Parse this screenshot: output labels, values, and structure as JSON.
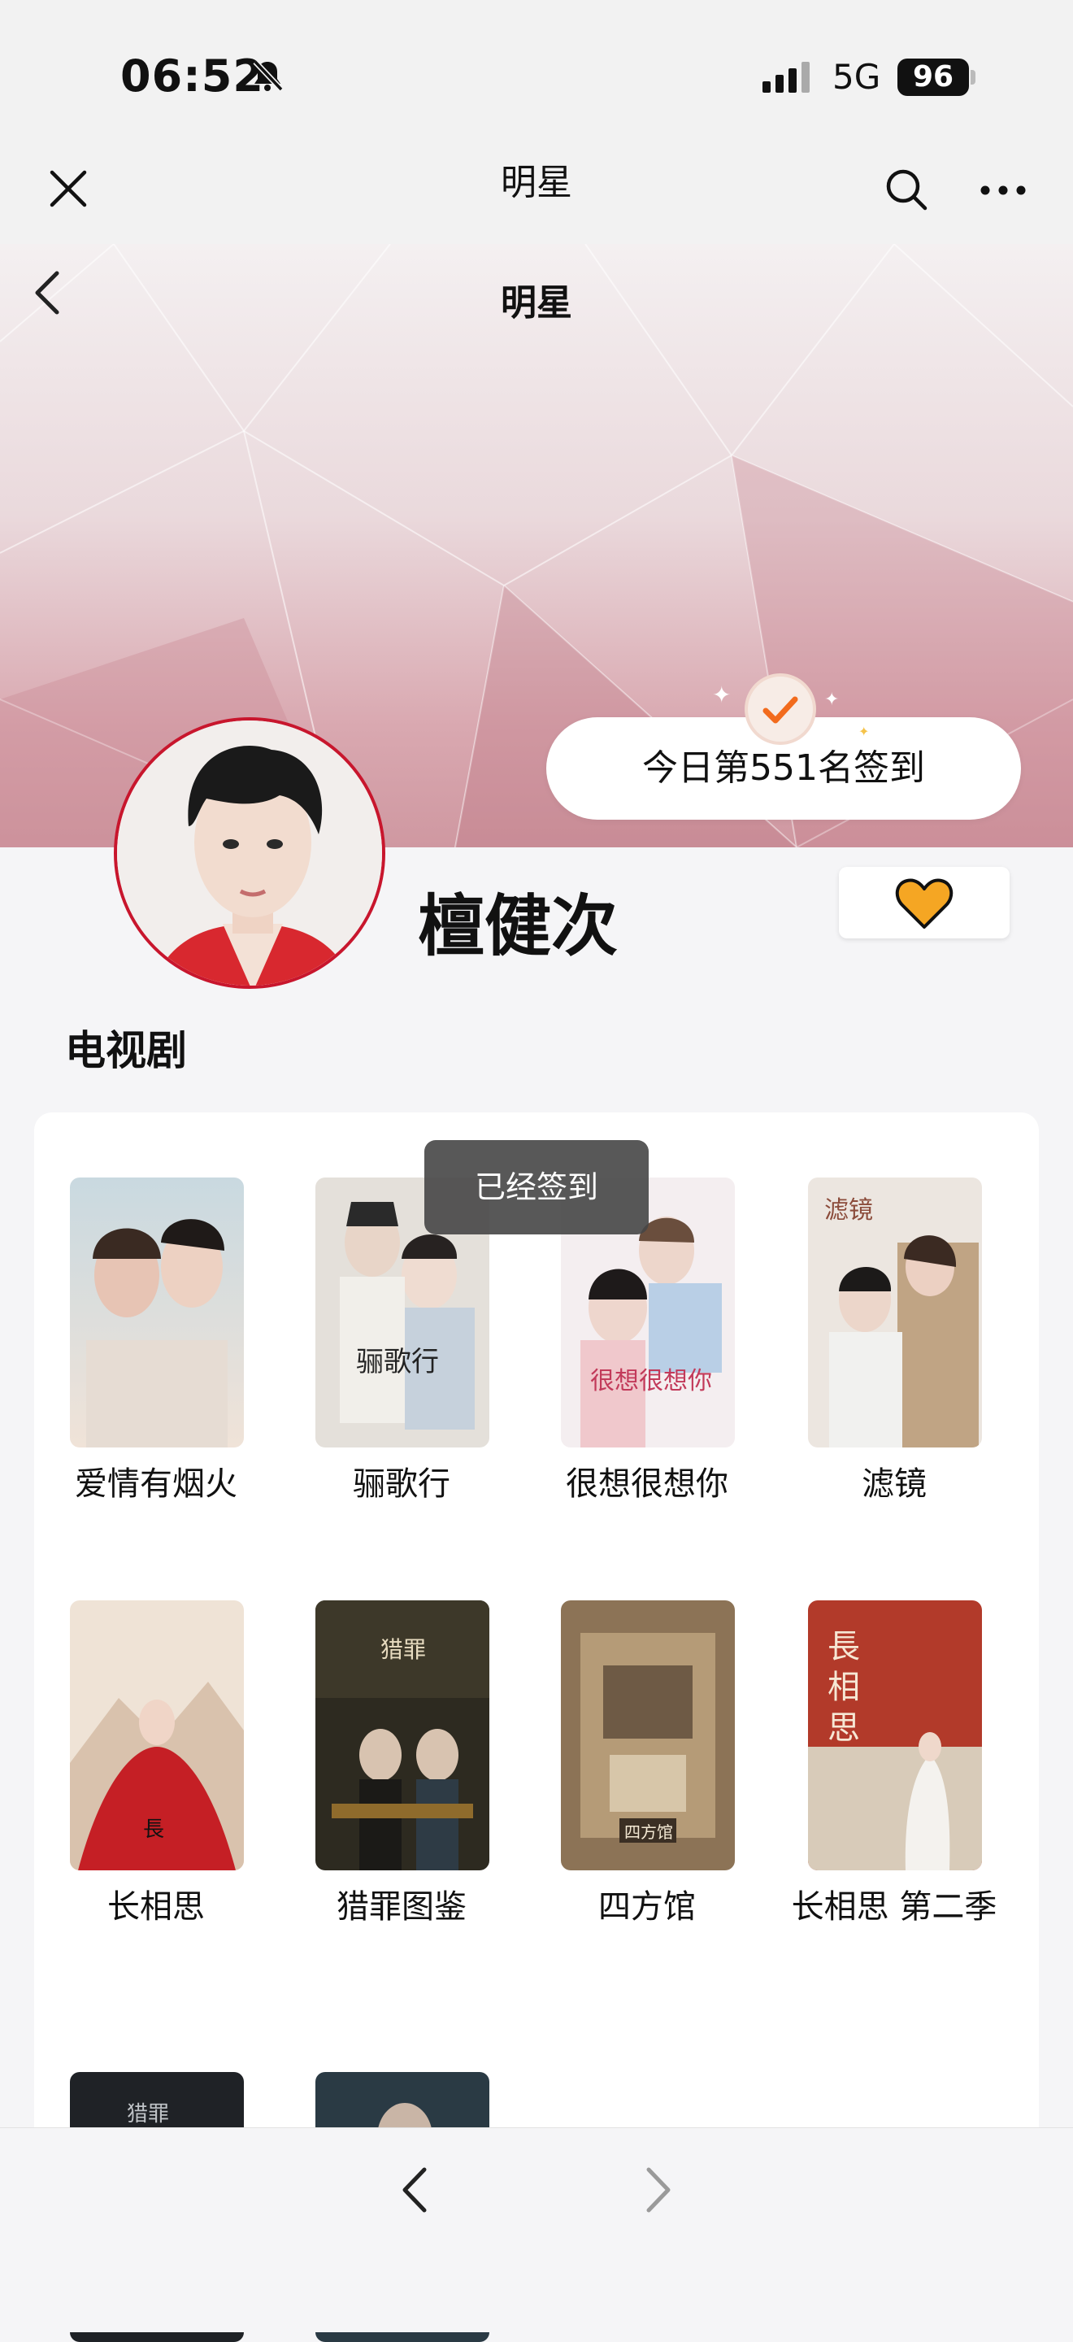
{
  "status_bar": {
    "time": "06:52",
    "network": "5G",
    "battery": "96"
  },
  "nav": {
    "title": "明星"
  },
  "header": {
    "title": "明星"
  },
  "checkin": {
    "label": "今日第551名签到"
  },
  "star": {
    "name": "檀健次"
  },
  "section": {
    "title": "电视剧"
  },
  "toast": {
    "text": "已经签到"
  },
  "dramas": [
    {
      "title": "爱情有烟火"
    },
    {
      "title": "骊歌行"
    },
    {
      "title": "很想很想你"
    },
    {
      "title": "滤镜"
    },
    {
      "title": "长相思"
    },
    {
      "title": "猎罪图鉴"
    },
    {
      "title": "四方馆"
    },
    {
      "title": "长相思 第二季"
    }
  ],
  "colors": {
    "accent": "#c8162d",
    "follow_heart": "#f5a623",
    "toast_bg": "#464646"
  }
}
